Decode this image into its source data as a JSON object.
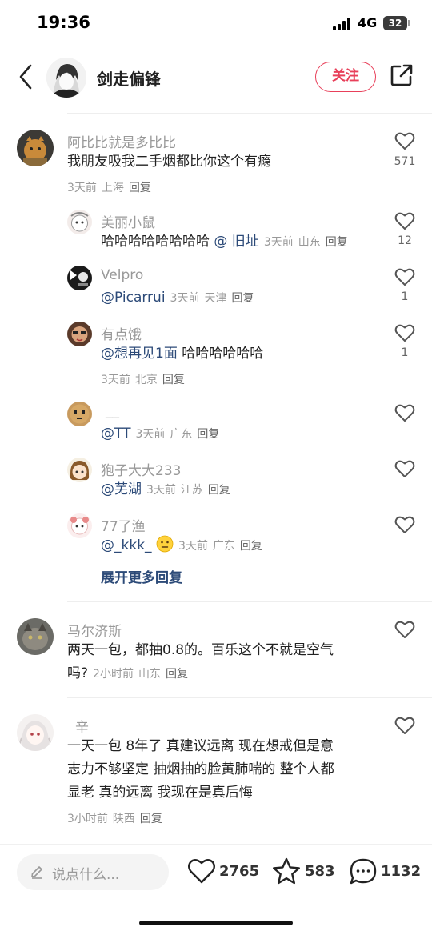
{
  "status_bar": {
    "time": "19:36",
    "network": "4G",
    "battery": "32"
  },
  "header": {
    "author_name": "剑走偏锋",
    "follow_label": "关注"
  },
  "comments": [
    {
      "user": "阿比比就是多比比",
      "text": "我朋友吸我二手烟都比你这个有瘾",
      "time": "3天前",
      "location": "上海",
      "reply": "回复",
      "likes": "571",
      "replies": [
        {
          "user": "美丽小鼠",
          "text": "哈哈哈哈哈哈哈哈",
          "mention": "@ 旧址",
          "time": "3天前",
          "location": "山东",
          "reply": "回复",
          "likes": "12"
        },
        {
          "user": "Velpro",
          "mention": "@Picarrui",
          "time": "3天前",
          "location": "天津",
          "reply": "回复",
          "likes": "1"
        },
        {
          "user": "有点饿",
          "mention": "@想再见1面",
          "text": "哈哈哈哈哈哈",
          "time": "3天前",
          "location": "北京",
          "reply": "回复",
          "likes": "1"
        },
        {
          "user": "__",
          "mention": "@TT",
          "time": "3天前",
          "location": "广东",
          "reply": "回复",
          "likes": ""
        },
        {
          "user": "狍子大大233",
          "mention": "@芜湖",
          "time": "3天前",
          "location": "江苏",
          "reply": "回复",
          "likes": ""
        },
        {
          "user": "77了渔",
          "mention": "@_kkk_",
          "time": "3天前",
          "location": "广东",
          "reply": "回复",
          "likes": ""
        }
      ],
      "expand_label": "展开更多回复"
    },
    {
      "user": "马尔济斯",
      "text_line1": "两天一包，都抽0.8的。百乐这个不就是空气",
      "text_line2": "吗?",
      "time": "2小时前",
      "location": "山东",
      "reply": "回复",
      "likes": ""
    },
    {
      "user": "辛",
      "text_line1": "一天一包 8年了 真建议远离 现在想戒但是意",
      "text_line2": "志力不够坚定  抽烟抽的脸黄肺喘的 整个人都",
      "text_line3": "显老 真的远离 我现在是真后悔",
      "time": "3小时前",
      "location": "陕西",
      "reply": "回复",
      "likes": ""
    }
  ],
  "bottom_bar": {
    "placeholder": "说点什么...",
    "likes": "2765",
    "stars": "583",
    "comments": "1132"
  },
  "colors": {
    "accent": "#e8405a",
    "mention": "#2c4a78",
    "muted": "#999999"
  },
  "icons": [
    "back-arrow-icon",
    "share-icon",
    "heart-icon",
    "star-icon",
    "comment-bubble-icon",
    "pencil-icon"
  ]
}
